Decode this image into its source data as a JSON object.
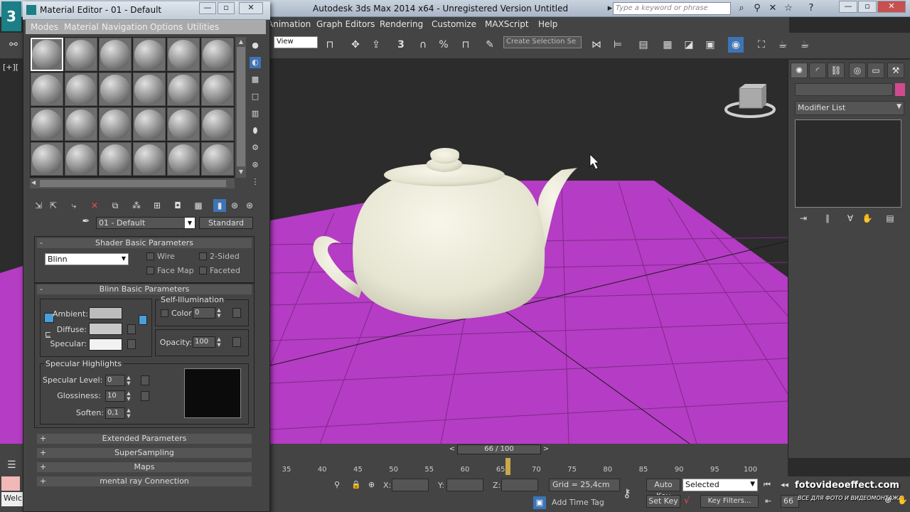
{
  "app": {
    "title": "Autodesk 3ds Max  2014 x64  -  Unregistered Version    Untitled",
    "logo": "3",
    "search_placeholder": "Type a keyword or phrase"
  },
  "menus": [
    "Animation",
    "Graph Editors",
    "Rendering",
    "Customize",
    "MAXScript",
    "Help"
  ],
  "toolbar": {
    "view_select": "View",
    "selection_set": "Create Selection Se",
    "snap_labels": [
      "3",
      "%"
    ]
  },
  "viewport": {
    "label": "[+][",
    "floor_color": "#b53cc4",
    "teapot_color": "#efeee0"
  },
  "command_panel": {
    "modifier_list": "Modifier List",
    "object_color": "#d04b8e"
  },
  "timeline": {
    "slider": "66 / 100",
    "ticks": [
      "35",
      "40",
      "45",
      "50",
      "55",
      "60",
      "65",
      "70",
      "75",
      "80",
      "85",
      "90",
      "95",
      "100"
    ]
  },
  "status": {
    "x_label": "X:",
    "y_label": "Y:",
    "z_label": "Z:",
    "grid": "Grid = 25,4cm",
    "add_time_tag": "Add Time Tag",
    "auto_key": "Auto Key",
    "set_key": "Set Key",
    "selected": "Selected",
    "key_filters": "Key Filters...",
    "frame": "66",
    "maxscript": "Welc"
  },
  "watermark": {
    "main": "fotovideoeffect.com",
    "sub": "ВСЕ ДЛЯ ФОТО И ВИДЕОМОНТАЖА"
  },
  "material_editor": {
    "title": "Material Editor - 01 - Default",
    "menus": [
      "Modes",
      "Material",
      "Navigation",
      "Options",
      "Utilities"
    ],
    "material_name": "01 - Default",
    "material_type": "Standard",
    "shader_rollout": {
      "title": "Shader Basic Parameters",
      "sign": "-",
      "shader": "Blinn",
      "wire": "Wire",
      "two_sided": "2-Sided",
      "face_map": "Face Map",
      "faceted": "Faceted"
    },
    "blinn_rollout": {
      "title": "Blinn Basic Parameters",
      "sign": "-",
      "self_illum": "Self-Illumination",
      "color_label": "Color",
      "color_value": "0",
      "ambient": "Ambient:",
      "diffuse": "Diffuse:",
      "specular": "Specular:",
      "opacity_label": "Opacity:",
      "opacity_value": "100",
      "ambient_color": "#bdbdbd",
      "diffuse_color": "#c8c8c8",
      "specular_color": "#f2f2f2",
      "spec_highlights": "Specular Highlights",
      "spec_level_label": "Specular Level:",
      "spec_level": "0",
      "glossiness_label": "Glossiness:",
      "glossiness": "10",
      "soften_label": "Soften:",
      "soften": "0,1"
    },
    "collapsed_rollouts": [
      {
        "sign": "+",
        "title": "Extended Parameters"
      },
      {
        "sign": "+",
        "title": "SuperSampling"
      },
      {
        "sign": "+",
        "title": "Maps"
      },
      {
        "sign": "+",
        "title": "mental ray Connection"
      }
    ]
  }
}
